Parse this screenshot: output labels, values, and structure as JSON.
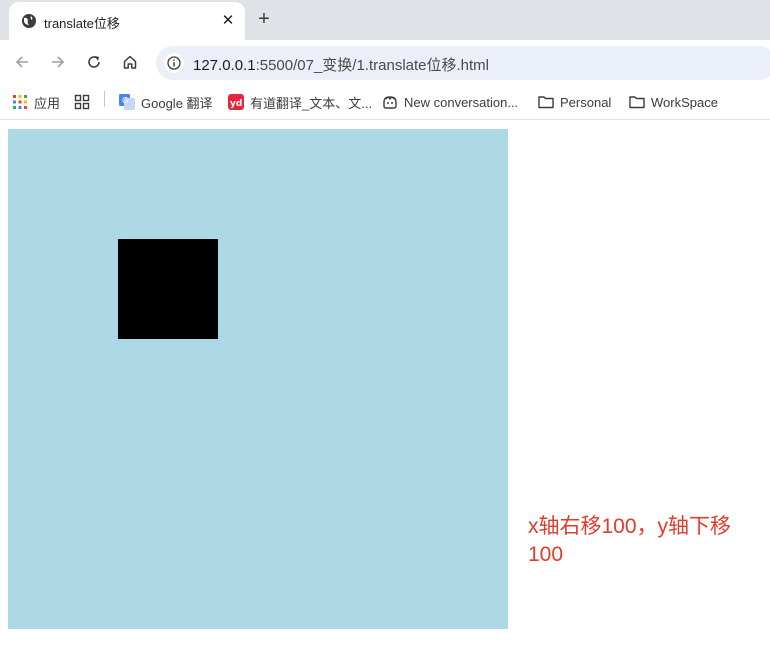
{
  "tab": {
    "title": "translate位移",
    "close_icon": "close-icon",
    "favicon": "globe-icon"
  },
  "newtab": {
    "label": "+"
  },
  "toolbar": {
    "back_icon": "back-arrow-icon",
    "forward_icon": "forward-arrow-icon",
    "reload_icon": "reload-icon",
    "home_icon": "home-icon"
  },
  "address": {
    "host": "127.0.0.1",
    "path": ":5500/07_变换/1.translate位移.html",
    "info_icon": "site-info-icon"
  },
  "bookmarks": {
    "apps": "应用",
    "google_translate": "Google 翻译",
    "youdao": "有道翻译_文本、文...",
    "copilot": "New conversation...",
    "personal": "Personal",
    "workspace": "WorkSpace"
  },
  "page": {
    "caption": "x轴右移100，y轴下移100",
    "colors": {
      "outer": "#add8e6",
      "inner": "#000000",
      "caption": "#e03c2a"
    }
  }
}
